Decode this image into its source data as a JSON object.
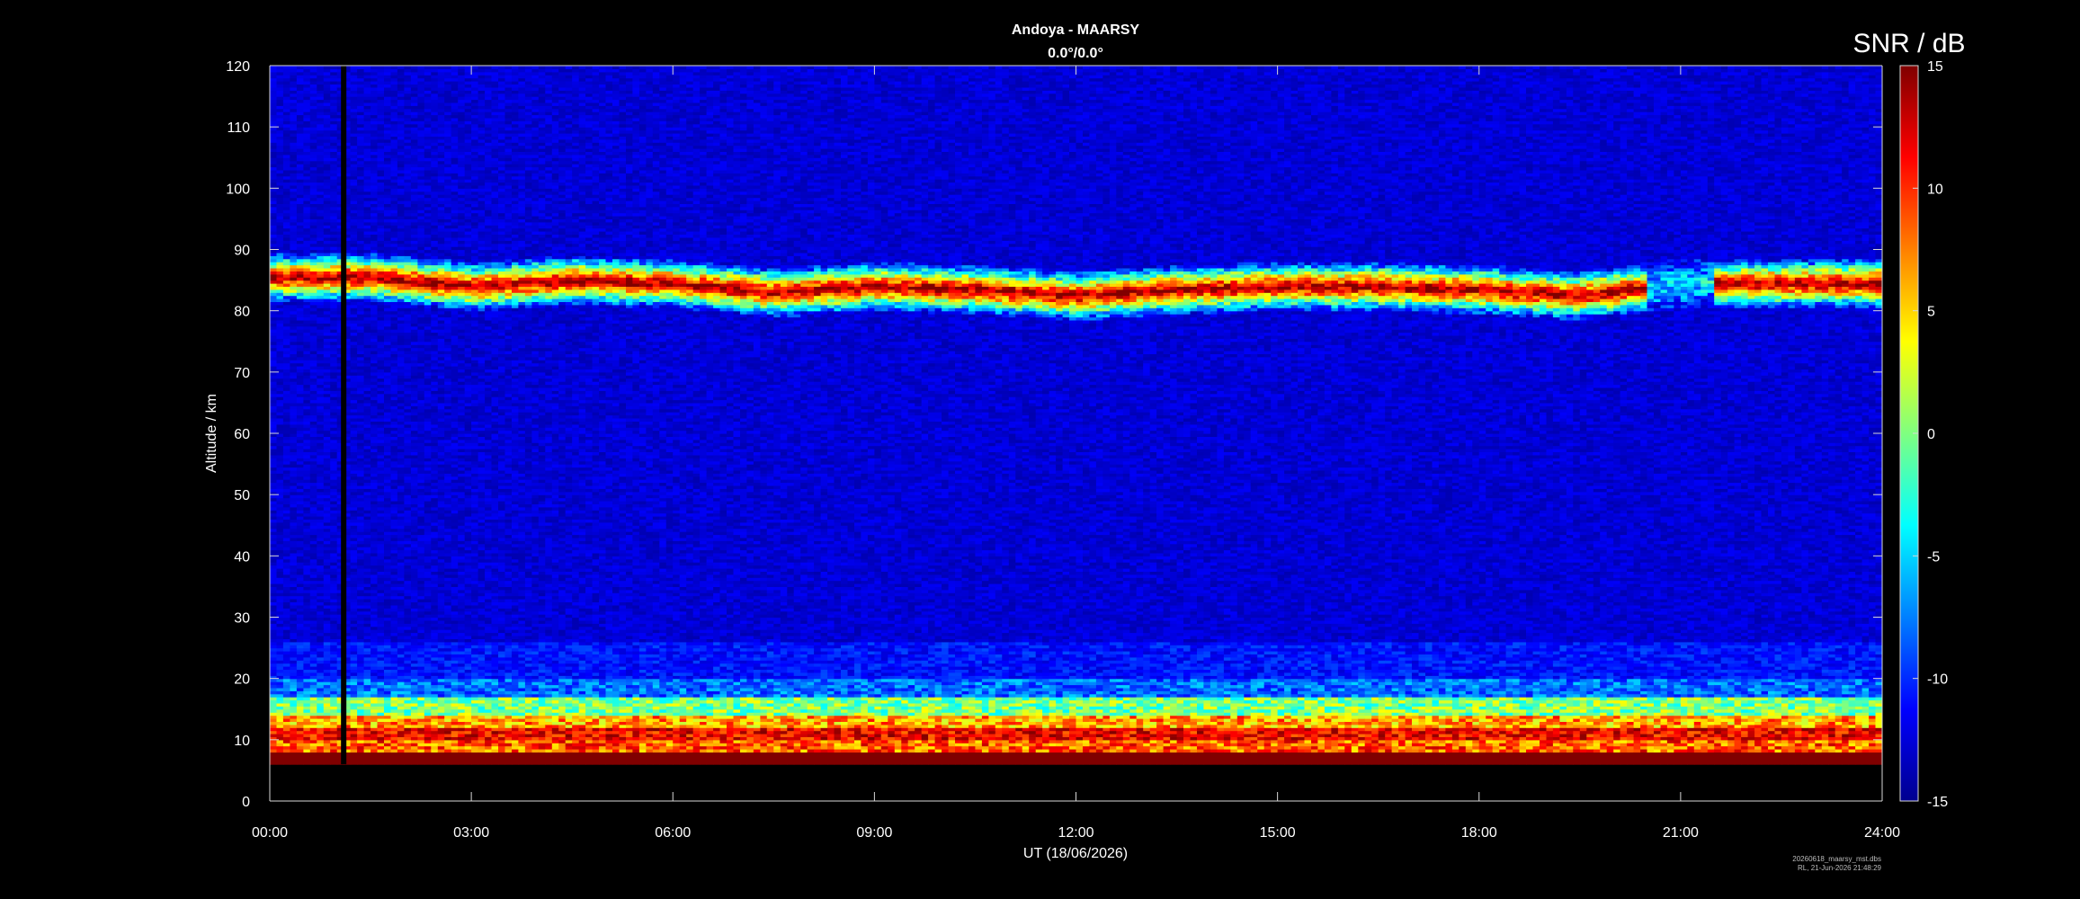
{
  "chart_data": {
    "type": "heatmap",
    "title": "Andoya - MAARSY",
    "subtitle": "0.0°/0.0°",
    "xlabel": "UT (18/06/2026)",
    "ylabel": "Altitude / km",
    "xlim": [
      "00:00",
      "24:00"
    ],
    "ylim": [
      0,
      120
    ],
    "x_ticks": [
      "00:00",
      "03:00",
      "06:00",
      "09:00",
      "12:00",
      "15:00",
      "18:00",
      "21:00",
      "24:00"
    ],
    "y_ticks": [
      0,
      10,
      20,
      30,
      40,
      50,
      60,
      70,
      80,
      90,
      100,
      110,
      120
    ],
    "colorbar": {
      "label": "SNR / dB",
      "range": [
        -15,
        15
      ],
      "ticks": [
        -15,
        -10,
        -5,
        0,
        5,
        10,
        15
      ],
      "colormap": "jet"
    },
    "data_gap": {
      "hour": 1.1,
      "alt_range": [
        6,
        120
      ]
    },
    "features": [
      {
        "name": "polar mesospheric summer echoes",
        "alt_km_center": [
          [
            0,
            85.5
          ],
          [
            1.5,
            85.5
          ],
          [
            3,
            84
          ],
          [
            4.5,
            85
          ],
          [
            6,
            84.5
          ],
          [
            7.5,
            83
          ],
          [
            9,
            84
          ],
          [
            10.5,
            83.5
          ],
          [
            12,
            82.5
          ],
          [
            13.5,
            83.5
          ],
          [
            15,
            84
          ],
          [
            16.5,
            84
          ],
          [
            18,
            83.5
          ],
          [
            19.5,
            82.5
          ],
          [
            21,
            84.5
          ],
          [
            22.5,
            84.5
          ],
          [
            24,
            84.5
          ]
        ],
        "hours": [
          0,
          24
        ]
      },
      {
        "name": "tropospheric echoes",
        "alt_km": [
          6,
          19
        ],
        "hours": [
          0,
          24
        ]
      }
    ]
  },
  "footer": {
    "filename": "20260618_maarsy_mst.dbs",
    "stamp": "RL, 21-Jun-2026 21:48:29"
  }
}
